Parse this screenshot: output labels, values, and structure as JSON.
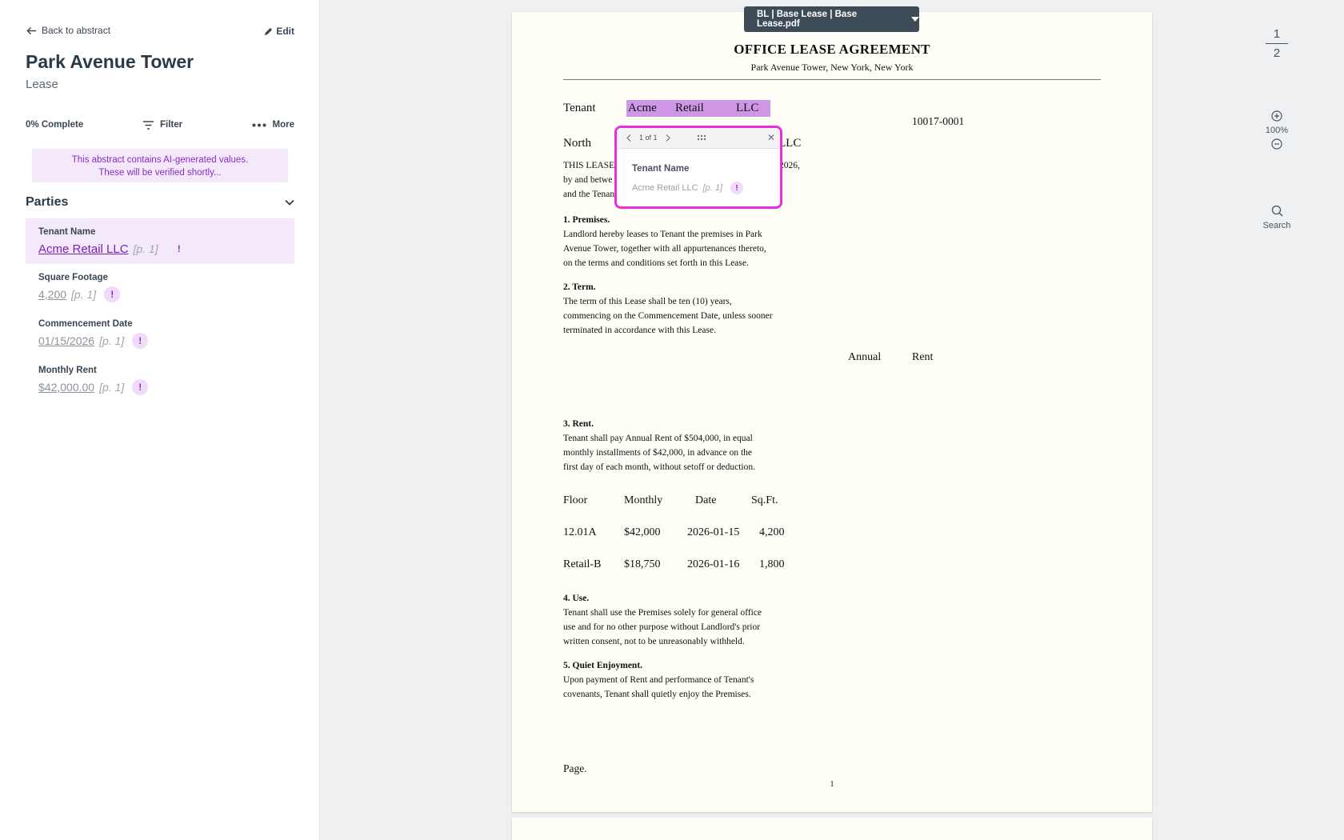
{
  "sidebar": {
    "back_label": "Back to abstract",
    "edit_label": "Edit",
    "title": "Park Avenue Tower",
    "subtitle": "Lease",
    "complete_label": "0% Complete",
    "filter_label": "Filter",
    "more_label": "More",
    "ai_banner_line1": "This abstract contains AI-generated values.",
    "ai_banner_line2": "These will be verified shortly...",
    "section_label": "Parties",
    "fields": [
      {
        "name": "Tenant Name",
        "value": "Acme Retail LLC",
        "page": "[p. 1]",
        "badge": "!"
      },
      {
        "name": "Square Footage",
        "value": "4,200",
        "page": "[p. 1]",
        "badge": "!"
      },
      {
        "name": "Commencement Date",
        "value": "01/15/2026",
        "page": "[p. 1]",
        "badge": "!"
      },
      {
        "name": "Monthly Rent",
        "value": "$42,000.00",
        "page": "[p. 1]",
        "badge": "!"
      }
    ]
  },
  "doc_tab": {
    "label": "BL | Base Lease | Base Lease.pdf"
  },
  "document": {
    "title": "OFFICE LEASE AGREEMENT",
    "subtitle": "Park Avenue Tower, New York, New York",
    "tenant_label": "Tenant",
    "tenant_words": [
      "Acme",
      "Retail",
      "LLC"
    ],
    "zip": "10017-0001",
    "north": "North",
    "north_llc": "LLC",
    "intro_1": "THIS LEASE",
    "intro_1_end": "2026,",
    "intro_2": "by and betwe",
    "intro_3": "and the Tenan",
    "s1_heading": "1. Premises.",
    "s1_lines": [
      "Landlord hereby leases to Tenant the premises in Park",
      "Avenue Tower, together with all appurtenances thereto,",
      "on the terms and conditions set forth in this Lease."
    ],
    "s2_heading": "2. Term.",
    "s2_lines": [
      "The term of this Lease shall be ten (10) years,",
      "commencing on the Commencement Date, unless sooner",
      "terminated in accordance with this Lease."
    ],
    "annual": "Annual",
    "rent": "Rent",
    "s3_heading": "3. Rent.",
    "s3_lines": [
      "Tenant shall pay Annual Rent of $504,000, in equal",
      "monthly installments of $42,000, in advance on the",
      "first day of each month, without setoff or deduction."
    ],
    "table": {
      "headers": [
        "Floor",
        "Monthly",
        "Date",
        "Sq.Ft."
      ],
      "rows": [
        [
          "12.01A",
          "$42,000",
          "2026-01-15",
          "4,200"
        ],
        [
          "Retail-B",
          "$18,750",
          "2026-01-16",
          "1,800"
        ]
      ]
    },
    "s4_heading": "4. Use.",
    "s4_lines": [
      "Tenant shall use the Premises solely for general office",
      "use and for no other purpose without Landlord's prior",
      "written consent, not to be unreasonably withheld."
    ],
    "s5_heading": "5. Quiet Enjoyment.",
    "s5_lines": [
      "Upon payment of Rent and performance of Tenant's",
      "covenants, Tenant shall quietly enjoy the Premises."
    ],
    "page_label": "Page.",
    "page_number": "1"
  },
  "popover": {
    "counter": "1 of 1",
    "title": "Tenant Name",
    "value": "Acme Retail LLC",
    "page": "[p. 1]",
    "badge": "!"
  },
  "rail": {
    "current_page": "1",
    "total_pages": "2",
    "zoom": "100%",
    "search_label": "Search"
  },
  "colors": {
    "accent_purple": "#8a2bc4",
    "highlight": "#cf96e6",
    "popover_border": "#ea2ddd",
    "tab_bg": "#3d4a58"
  }
}
